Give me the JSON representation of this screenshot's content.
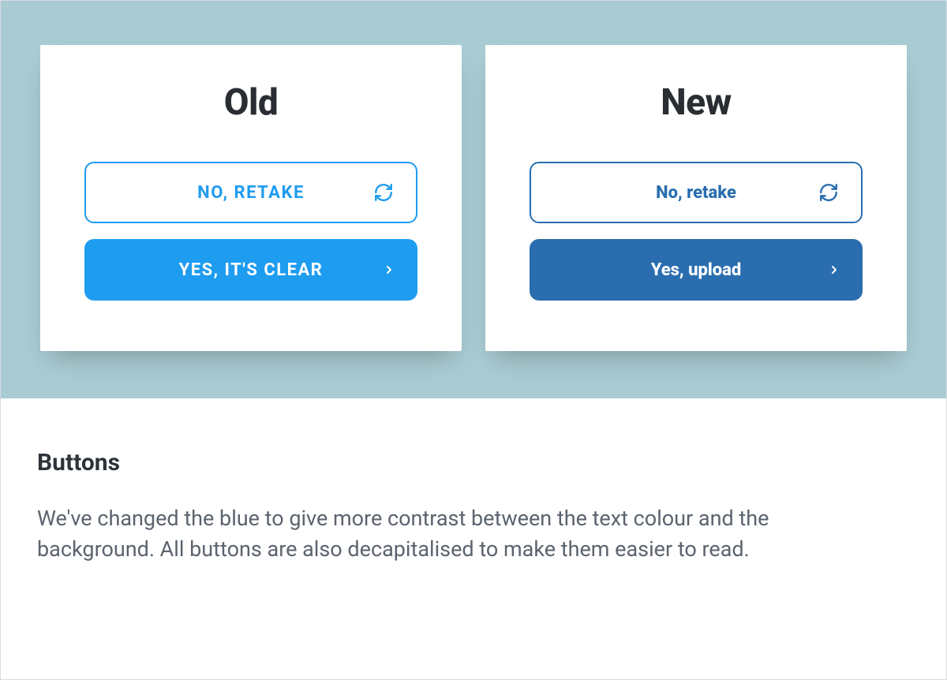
{
  "comparison": {
    "old": {
      "title": "Old",
      "retake_label": "NO, RETAKE",
      "confirm_label": "YES, IT'S CLEAR"
    },
    "new": {
      "title": "New",
      "retake_label": "No, retake",
      "confirm_label": "Yes, upload"
    }
  },
  "caption": {
    "heading": "Buttons",
    "body": "We've changed the blue to give more contrast between the text colour and the background. All buttons are also decapitalised to make them easier to read."
  },
  "colors": {
    "panel_bg": "#a9cbd3",
    "old_blue": "#1e9cf0",
    "new_blue": "#2a6eb0"
  }
}
